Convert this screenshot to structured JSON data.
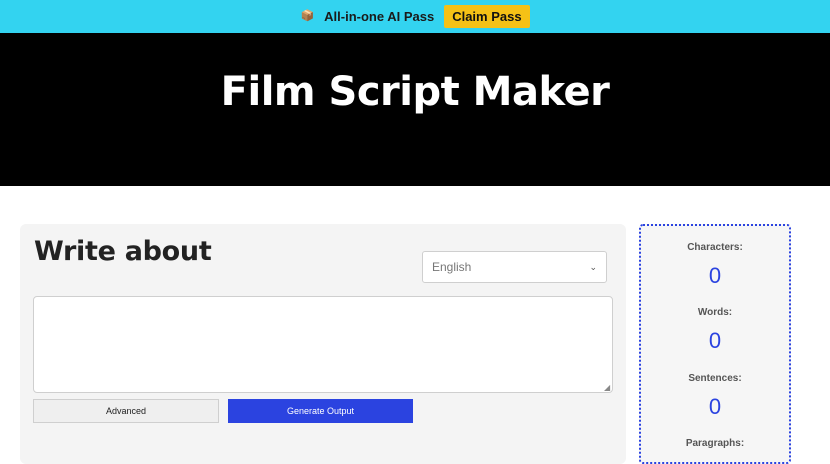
{
  "promo": {
    "icon": "📦",
    "text": "All-in-one AI Pass",
    "button": "Claim Pass"
  },
  "hero": {
    "title": "Film Script Maker"
  },
  "form": {
    "title": "Write about",
    "language": "English",
    "input_value": "",
    "advanced_label": "Advanced",
    "generate_label": "Generate Output"
  },
  "stats": [
    {
      "label": "Characters:",
      "value": "0"
    },
    {
      "label": "Words:",
      "value": "0"
    },
    {
      "label": "Sentences:",
      "value": "0"
    },
    {
      "label": "Paragraphs:",
      "value": ""
    }
  ],
  "colors": {
    "promo_bg": "#33d3f0",
    "claim_button": "#f5c116",
    "hero_bg": "#000000",
    "accent_blue": "#2b43e0"
  }
}
